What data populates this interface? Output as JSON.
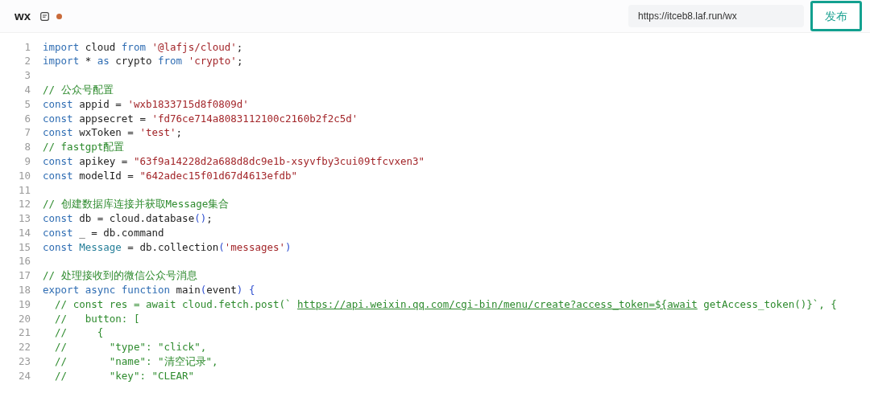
{
  "tab": {
    "title": "wx",
    "modified": true
  },
  "url_field": {
    "value": "https://itceb8.laf.run/wx"
  },
  "publish_button": {
    "label": "发布"
  },
  "code_lines": [
    {
      "number": "1",
      "tokens": [
        {
          "kind": "keyword",
          "text": "import"
        },
        {
          "kind": "plain",
          "text": " cloud "
        },
        {
          "kind": "keyword",
          "text": "from "
        },
        {
          "kind": "string",
          "text": "'@lafjs/cloud'"
        },
        {
          "kind": "plain",
          "text": ";"
        }
      ]
    },
    {
      "number": "2",
      "tokens": [
        {
          "kind": "keyword",
          "text": "import"
        },
        {
          "kind": "plain",
          "text": " * "
        },
        {
          "kind": "keyword",
          "text": "as"
        },
        {
          "kind": "plain",
          "text": " crypto "
        },
        {
          "kind": "keyword",
          "text": "from "
        },
        {
          "kind": "string",
          "text": "'crypto'"
        },
        {
          "kind": "plain",
          "text": ";"
        }
      ]
    },
    {
      "number": "3"
    },
    {
      "number": "4",
      "tokens": [
        {
          "kind": "comment",
          "text": "// 公众号配置"
        }
      ]
    },
    {
      "number": "5",
      "tokens": [
        {
          "kind": "keyword",
          "text": "const"
        },
        {
          "kind": "plain",
          "text": " appid = "
        },
        {
          "kind": "string",
          "text": "'wxb1833715d8f0809d'"
        }
      ]
    },
    {
      "number": "6",
      "tokens": [
        {
          "kind": "keyword",
          "text": "const"
        },
        {
          "kind": "plain",
          "text": " appsecret = "
        },
        {
          "kind": "string",
          "text": "'fd76ce714a8083112100c2160b2f2c5d'"
        }
      ]
    },
    {
      "number": "7",
      "tokens": [
        {
          "kind": "keyword",
          "text": "const"
        },
        {
          "kind": "plain",
          "text": " wxToken = "
        },
        {
          "kind": "string",
          "text": "'test'"
        },
        {
          "kind": "plain",
          "text": ";"
        }
      ]
    },
    {
      "number": "8",
      "tokens": [
        {
          "kind": "comment",
          "text": "// fastgpt配置"
        }
      ]
    },
    {
      "number": "9",
      "tokens": [
        {
          "kind": "keyword",
          "text": "const"
        },
        {
          "kind": "plain",
          "text": " apikey = "
        },
        {
          "kind": "string",
          "text": "\"63f9a14228d2a688d8dc9e1b-xsyvfby3cui09tfcvxen3\""
        }
      ]
    },
    {
      "number": "10",
      "tokens": [
        {
          "kind": "keyword",
          "text": "const"
        },
        {
          "kind": "plain",
          "text": " modelId = "
        },
        {
          "kind": "string",
          "text": "\"642adec15f01d67d4613efdb\""
        }
      ]
    },
    {
      "number": "11"
    },
    {
      "number": "12",
      "tokens": [
        {
          "kind": "comment",
          "text": "// 创建数据库连接并获取Message集合"
        }
      ]
    },
    {
      "number": "13",
      "tokens": [
        {
          "kind": "keyword",
          "text": "const"
        },
        {
          "kind": "plain",
          "text": " db = cloud.database"
        },
        {
          "kind": "bracket",
          "text": "()"
        },
        {
          "kind": "plain",
          "text": ";"
        }
      ]
    },
    {
      "number": "14",
      "tokens": [
        {
          "kind": "keyword",
          "text": "const"
        },
        {
          "kind": "plain",
          "text": " _ = db.command"
        }
      ]
    },
    {
      "number": "15",
      "tokens": [
        {
          "kind": "keyword",
          "text": "const "
        },
        {
          "kind": "type",
          "text": "Message"
        },
        {
          "kind": "plain",
          "text": " = db.collection"
        },
        {
          "kind": "bracket",
          "text": "("
        },
        {
          "kind": "string",
          "text": "'messages'"
        },
        {
          "kind": "bracket",
          "text": ")"
        }
      ]
    },
    {
      "number": "16"
    },
    {
      "number": "17",
      "tokens": [
        {
          "kind": "comment",
          "text": "// 处理接收到的微信公众号消息"
        }
      ]
    },
    {
      "number": "18",
      "tokens": [
        {
          "kind": "keyword",
          "text": "export async function"
        },
        {
          "kind": "plain",
          "text": " main"
        },
        {
          "kind": "bracket",
          "text": "("
        },
        {
          "kind": "plain",
          "text": "event"
        },
        {
          "kind": "bracket",
          "text": ") {"
        }
      ]
    },
    {
      "number": "19",
      "tokens": [
        {
          "kind": "comment",
          "text": "  // const res = await cloud.fetch.post(` "
        },
        {
          "kind": "link",
          "text": "https://api.weixin.qq.com/cgi-bin/menu/create?access_token=${await"
        },
        {
          "kind": "comment",
          "text": " getAccess_token()}`, {"
        }
      ]
    },
    {
      "number": "20",
      "tokens": [
        {
          "kind": "comment",
          "text": "  //   button: ["
        }
      ]
    },
    {
      "number": "21",
      "tokens": [
        {
          "kind": "comment",
          "text": "  //     {"
        }
      ]
    },
    {
      "number": "22",
      "tokens": [
        {
          "kind": "comment",
          "text": "  //       \"type\": \"click\","
        }
      ]
    },
    {
      "number": "23",
      "tokens": [
        {
          "kind": "comment",
          "text": "  //       \"name\": \"清空记录\","
        }
      ]
    },
    {
      "number": "24",
      "tokens": [
        {
          "kind": "comment",
          "text": "  //       \"key\": \"CLEAR\""
        }
      ]
    }
  ]
}
